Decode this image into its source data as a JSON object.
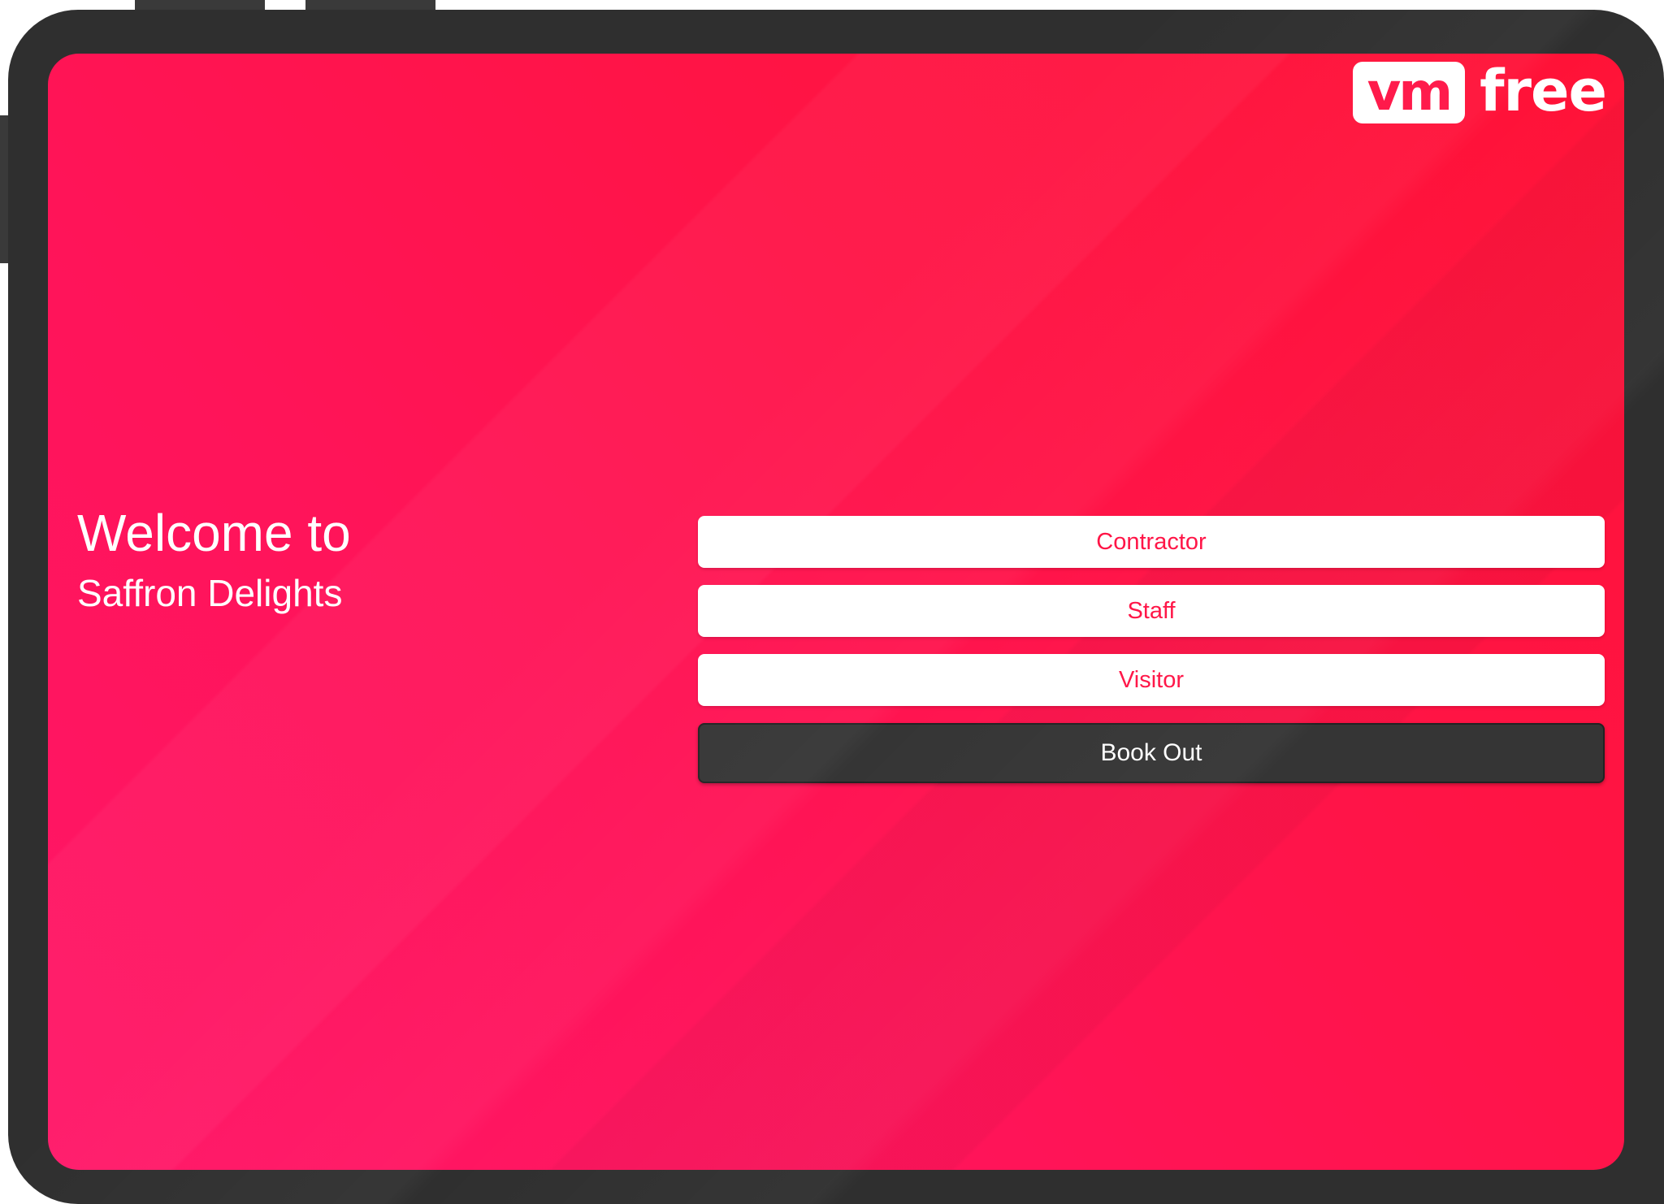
{
  "brand": {
    "logo_mark": "vm",
    "logo_word": "free",
    "accent_color": "#ff1446",
    "frame_color": "#2f2f2f"
  },
  "welcome": {
    "title": "Welcome to",
    "organization": "Saffron Delights"
  },
  "options": [
    {
      "label": "Contractor"
    },
    {
      "label": "Staff"
    },
    {
      "label": "Visitor"
    }
  ],
  "book_out": {
    "label": "Book Out"
  }
}
